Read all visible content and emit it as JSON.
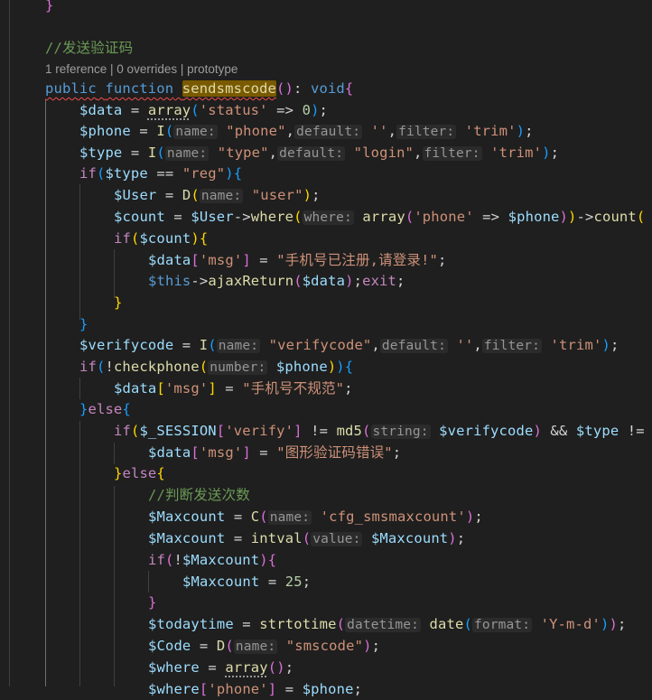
{
  "codelens": "1 reference | 0 overrides | prototype",
  "lines": {
    "l0": [
      {
        "t": "}",
        "c": "br2"
      }
    ],
    "l1": [],
    "l2": [
      {
        "t": "//发送验证码",
        "c": "cmt"
      }
    ],
    "l3": [
      {
        "t": "public",
        "c": "kw squig"
      },
      {
        "t": " ",
        "c": "squig"
      },
      {
        "t": "function",
        "c": "kw squig"
      },
      {
        "t": " ",
        "c": "squig"
      },
      {
        "t": "sendsmscode",
        "c": "fn hl squig"
      },
      {
        "t": "()",
        "c": "br2"
      },
      {
        "t": ": ",
        "c": ""
      },
      {
        "t": "void",
        "c": "kw"
      },
      {
        "t": "{",
        "c": "br2"
      }
    ],
    "l4": [
      {
        "t": "$data",
        "c": "var"
      },
      {
        "t": " = ",
        "c": ""
      },
      {
        "t": "array",
        "c": "fn dots"
      },
      {
        "t": "(",
        "c": "br3"
      },
      {
        "t": "'status'",
        "c": "str"
      },
      {
        "t": " => ",
        "c": ""
      },
      {
        "t": "0",
        "c": "num"
      },
      {
        "t": ")",
        "c": "br3"
      },
      {
        "t": ";",
        "c": ""
      }
    ],
    "l5": [
      {
        "t": "$phone",
        "c": "var"
      },
      {
        "t": " = ",
        "c": ""
      },
      {
        "t": "I",
        "c": "fn"
      },
      {
        "t": "(",
        "c": "br3"
      },
      {
        "t": "name:",
        "c": "hint"
      },
      {
        "t": " ",
        "c": ""
      },
      {
        "t": "\"phone\"",
        "c": "str"
      },
      {
        "t": ",",
        "c": ""
      },
      {
        "t": "default:",
        "c": "hint"
      },
      {
        "t": " ",
        "c": ""
      },
      {
        "t": "''",
        "c": "str"
      },
      {
        "t": ",",
        "c": ""
      },
      {
        "t": "filter:",
        "c": "hint"
      },
      {
        "t": " ",
        "c": ""
      },
      {
        "t": "'trim'",
        "c": "str"
      },
      {
        "t": ")",
        "c": "br3"
      },
      {
        "t": ";",
        "c": ""
      }
    ],
    "l6": [
      {
        "t": "$type",
        "c": "var"
      },
      {
        "t": " = ",
        "c": ""
      },
      {
        "t": "I",
        "c": "fn"
      },
      {
        "t": "(",
        "c": "br3"
      },
      {
        "t": "name:",
        "c": "hint"
      },
      {
        "t": " ",
        "c": ""
      },
      {
        "t": "\"type\"",
        "c": "str"
      },
      {
        "t": ",",
        "c": ""
      },
      {
        "t": "default:",
        "c": "hint"
      },
      {
        "t": " ",
        "c": ""
      },
      {
        "t": "\"login\"",
        "c": "str"
      },
      {
        "t": ",",
        "c": ""
      },
      {
        "t": "filter:",
        "c": "hint"
      },
      {
        "t": " ",
        "c": ""
      },
      {
        "t": "'trim'",
        "c": "str"
      },
      {
        "t": ")",
        "c": "br3"
      },
      {
        "t": ";",
        "c": ""
      }
    ],
    "l7": [
      {
        "t": "if",
        "c": "ctl"
      },
      {
        "t": "(",
        "c": "br3"
      },
      {
        "t": "$type",
        "c": "var"
      },
      {
        "t": " == ",
        "c": ""
      },
      {
        "t": "\"reg\"",
        "c": "str"
      },
      {
        "t": ")",
        "c": "br3"
      },
      {
        "t": "{",
        "c": "br3"
      }
    ],
    "l8": [
      {
        "t": "$User",
        "c": "var"
      },
      {
        "t": " = ",
        "c": ""
      },
      {
        "t": "D",
        "c": "fn"
      },
      {
        "t": "(",
        "c": "br1"
      },
      {
        "t": "name:",
        "c": "hint"
      },
      {
        "t": " ",
        "c": ""
      },
      {
        "t": "\"user\"",
        "c": "str"
      },
      {
        "t": ")",
        "c": "br1"
      },
      {
        "t": ";",
        "c": ""
      }
    ],
    "l9": [
      {
        "t": "$count",
        "c": "var"
      },
      {
        "t": " = ",
        "c": ""
      },
      {
        "t": "$User",
        "c": "var"
      },
      {
        "t": "->",
        "c": ""
      },
      {
        "t": "where",
        "c": "fn"
      },
      {
        "t": "(",
        "c": "br1"
      },
      {
        "t": "where:",
        "c": "hint"
      },
      {
        "t": " ",
        "c": ""
      },
      {
        "t": "array",
        "c": "fn"
      },
      {
        "t": "(",
        "c": "br2"
      },
      {
        "t": "'phone'",
        "c": "str"
      },
      {
        "t": " => ",
        "c": ""
      },
      {
        "t": "$phone",
        "c": "var"
      },
      {
        "t": ")",
        "c": "br2"
      },
      {
        "t": ")",
        "c": "br1"
      },
      {
        "t": "->",
        "c": ""
      },
      {
        "t": "count",
        "c": "fn"
      },
      {
        "t": "(",
        "c": "br1"
      }
    ],
    "l10": [
      {
        "t": "if",
        "c": "ctl"
      },
      {
        "t": "(",
        "c": "br1"
      },
      {
        "t": "$count",
        "c": "var"
      },
      {
        "t": ")",
        "c": "br1"
      },
      {
        "t": "{",
        "c": "br1"
      }
    ],
    "l11": [
      {
        "t": "$data",
        "c": "var"
      },
      {
        "t": "[",
        "c": "br2"
      },
      {
        "t": "'msg'",
        "c": "str"
      },
      {
        "t": "]",
        "c": "br2"
      },
      {
        "t": " = ",
        "c": ""
      },
      {
        "t": "\"手机号已注册,请登录!\"",
        "c": "str"
      },
      {
        "t": ";",
        "c": ""
      }
    ],
    "l12": [
      {
        "t": "$this",
        "c": "kw"
      },
      {
        "t": "->",
        "c": ""
      },
      {
        "t": "ajaxReturn",
        "c": "fn"
      },
      {
        "t": "(",
        "c": "br2"
      },
      {
        "t": "$data",
        "c": "var"
      },
      {
        "t": ")",
        "c": "br2"
      },
      {
        "t": ";",
        "c": ""
      },
      {
        "t": "exit",
        "c": "ctl"
      },
      {
        "t": ";",
        "c": ""
      }
    ],
    "l13": [
      {
        "t": "}",
        "c": "br1"
      }
    ],
    "l14": [
      {
        "t": "}",
        "c": "br3"
      }
    ],
    "l15": [
      {
        "t": "$verifycode",
        "c": "var"
      },
      {
        "t": " = ",
        "c": ""
      },
      {
        "t": "I",
        "c": "fn"
      },
      {
        "t": "(",
        "c": "br3"
      },
      {
        "t": "name:",
        "c": "hint"
      },
      {
        "t": " ",
        "c": ""
      },
      {
        "t": "\"verifycode\"",
        "c": "str"
      },
      {
        "t": ",",
        "c": ""
      },
      {
        "t": "default:",
        "c": "hint"
      },
      {
        "t": " ",
        "c": ""
      },
      {
        "t": "''",
        "c": "str"
      },
      {
        "t": ",",
        "c": ""
      },
      {
        "t": "filter:",
        "c": "hint"
      },
      {
        "t": " ",
        "c": ""
      },
      {
        "t": "'trim'",
        "c": "str"
      },
      {
        "t": ")",
        "c": "br3"
      },
      {
        "t": ";",
        "c": ""
      }
    ],
    "l16": [
      {
        "t": "if",
        "c": "ctl"
      },
      {
        "t": "(",
        "c": "br3"
      },
      {
        "t": "!",
        "c": ""
      },
      {
        "t": "checkphone",
        "c": "fn"
      },
      {
        "t": "(",
        "c": "br1"
      },
      {
        "t": "number:",
        "c": "hint"
      },
      {
        "t": " ",
        "c": ""
      },
      {
        "t": "$phone",
        "c": "var"
      },
      {
        "t": ")",
        "c": "br1"
      },
      {
        "t": ")",
        "c": "br3"
      },
      {
        "t": "{",
        "c": "br3"
      }
    ],
    "l17": [
      {
        "t": "$data",
        "c": "var"
      },
      {
        "t": "[",
        "c": "br1"
      },
      {
        "t": "'msg'",
        "c": "str"
      },
      {
        "t": "]",
        "c": "br1"
      },
      {
        "t": " = ",
        "c": ""
      },
      {
        "t": "\"手机号不规范\"",
        "c": "str"
      },
      {
        "t": ";",
        "c": ""
      }
    ],
    "l18": [
      {
        "t": "}",
        "c": "br3"
      },
      {
        "t": "else",
        "c": "ctl"
      },
      {
        "t": "{",
        "c": "br3"
      }
    ],
    "l19": [
      {
        "t": "if",
        "c": "ctl"
      },
      {
        "t": "(",
        "c": "br1"
      },
      {
        "t": "$_SESSION",
        "c": "var"
      },
      {
        "t": "[",
        "c": "br2"
      },
      {
        "t": "'verify'",
        "c": "str"
      },
      {
        "t": "]",
        "c": "br2"
      },
      {
        "t": " != ",
        "c": ""
      },
      {
        "t": "md5",
        "c": "fn"
      },
      {
        "t": "(",
        "c": "br2"
      },
      {
        "t": "string:",
        "c": "hint"
      },
      {
        "t": " ",
        "c": ""
      },
      {
        "t": "$verifycode",
        "c": "var"
      },
      {
        "t": ")",
        "c": "br2"
      },
      {
        "t": " && ",
        "c": ""
      },
      {
        "t": "$type",
        "c": "var"
      },
      {
        "t": " !=",
        "c": ""
      }
    ],
    "l20": [
      {
        "t": "$data",
        "c": "var"
      },
      {
        "t": "[",
        "c": "br2"
      },
      {
        "t": "'msg'",
        "c": "str"
      },
      {
        "t": "]",
        "c": "br2"
      },
      {
        "t": " = ",
        "c": ""
      },
      {
        "t": "\"图形验证码错误\"",
        "c": "str"
      },
      {
        "t": ";",
        "c": ""
      }
    ],
    "l21": [
      {
        "t": "}",
        "c": "br1"
      },
      {
        "t": "else",
        "c": "ctl"
      },
      {
        "t": "{",
        "c": "br1"
      }
    ],
    "l22": [
      {
        "t": "//判断发送次数",
        "c": "cmt"
      }
    ],
    "l23": [
      {
        "t": "$Maxcount",
        "c": "var"
      },
      {
        "t": " = ",
        "c": ""
      },
      {
        "t": "C",
        "c": "fn"
      },
      {
        "t": "(",
        "c": "br2"
      },
      {
        "t": "name:",
        "c": "hint"
      },
      {
        "t": " ",
        "c": ""
      },
      {
        "t": "'cfg_smsmaxcount'",
        "c": "str"
      },
      {
        "t": ")",
        "c": "br2"
      },
      {
        "t": ";",
        "c": ""
      }
    ],
    "l24": [
      {
        "t": "$Maxcount",
        "c": "var"
      },
      {
        "t": " = ",
        "c": ""
      },
      {
        "t": "intval",
        "c": "fn"
      },
      {
        "t": "(",
        "c": "br2"
      },
      {
        "t": "value:",
        "c": "hint"
      },
      {
        "t": " ",
        "c": ""
      },
      {
        "t": "$Maxcount",
        "c": "var"
      },
      {
        "t": ")",
        "c": "br2"
      },
      {
        "t": ";",
        "c": ""
      }
    ],
    "l25": [
      {
        "t": "if",
        "c": "ctl"
      },
      {
        "t": "(",
        "c": "br2"
      },
      {
        "t": "!",
        "c": ""
      },
      {
        "t": "$Maxcount",
        "c": "var"
      },
      {
        "t": ")",
        "c": "br2"
      },
      {
        "t": "{",
        "c": "br2"
      }
    ],
    "l26": [
      {
        "t": "$Maxcount",
        "c": "var"
      },
      {
        "t": " = ",
        "c": ""
      },
      {
        "t": "25",
        "c": "num"
      },
      {
        "t": ";",
        "c": ""
      }
    ],
    "l27": [
      {
        "t": "}",
        "c": "br2"
      }
    ],
    "l28": [
      {
        "t": "$todaytime",
        "c": "var"
      },
      {
        "t": " = ",
        "c": ""
      },
      {
        "t": "strtotime",
        "c": "fn"
      },
      {
        "t": "(",
        "c": "br2"
      },
      {
        "t": "datetime:",
        "c": "hint"
      },
      {
        "t": " ",
        "c": ""
      },
      {
        "t": "date",
        "c": "fn"
      },
      {
        "t": "(",
        "c": "br3"
      },
      {
        "t": "format:",
        "c": "hint"
      },
      {
        "t": " ",
        "c": ""
      },
      {
        "t": "'Y-m-d'",
        "c": "str"
      },
      {
        "t": ")",
        "c": "br3"
      },
      {
        "t": ")",
        "c": "br2"
      },
      {
        "t": ";",
        "c": ""
      }
    ],
    "l29": [
      {
        "t": "$Code",
        "c": "var"
      },
      {
        "t": " = ",
        "c": ""
      },
      {
        "t": "D",
        "c": "fn"
      },
      {
        "t": "(",
        "c": "br2"
      },
      {
        "t": "name:",
        "c": "hint"
      },
      {
        "t": " ",
        "c": ""
      },
      {
        "t": "\"smscode\"",
        "c": "str"
      },
      {
        "t": ")",
        "c": "br2"
      },
      {
        "t": ";",
        "c": ""
      }
    ],
    "l30": [
      {
        "t": "$where",
        "c": "var"
      },
      {
        "t": " = ",
        "c": ""
      },
      {
        "t": "array",
        "c": "fn dots"
      },
      {
        "t": "()",
        "c": "br2"
      },
      {
        "t": ";",
        "c": ""
      }
    ],
    "l31": [
      {
        "t": "$where",
        "c": "var"
      },
      {
        "t": "[",
        "c": "br2"
      },
      {
        "t": "'phone'",
        "c": "str"
      },
      {
        "t": "]",
        "c": "br2"
      },
      {
        "t": " = ",
        "c": ""
      },
      {
        "t": "$phone",
        "c": "var"
      },
      {
        "t": ";",
        "c": ""
      }
    ]
  }
}
